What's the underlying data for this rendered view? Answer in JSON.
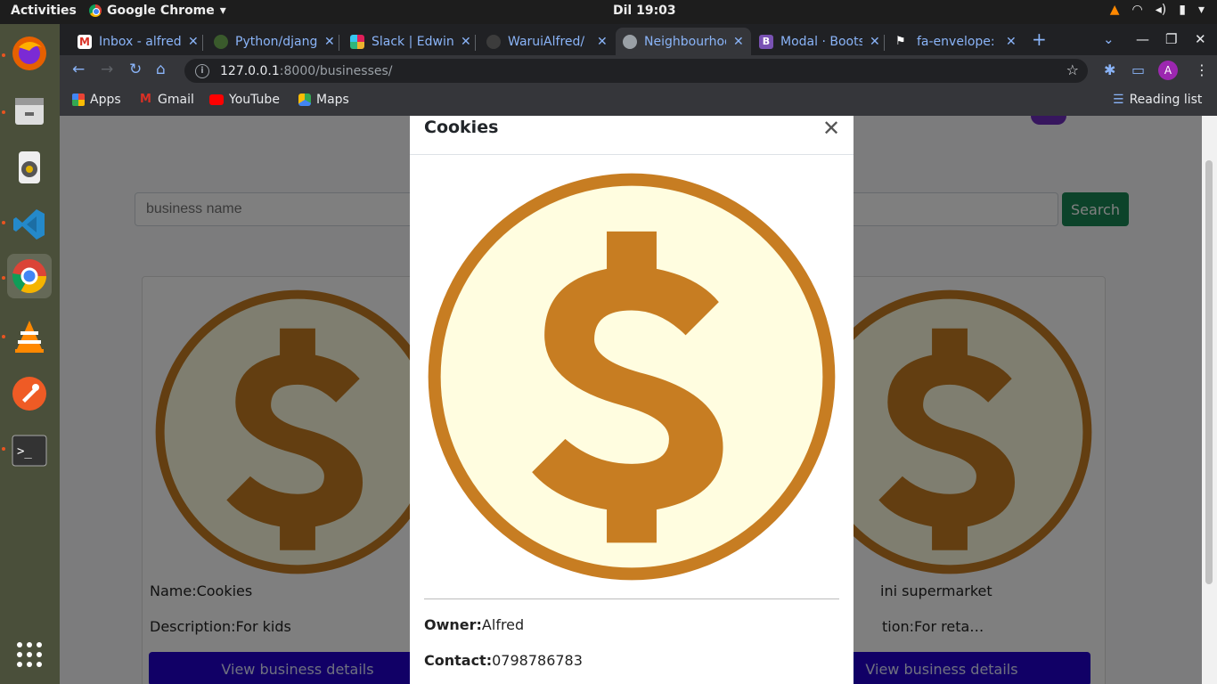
{
  "system": {
    "activities": "Activities",
    "app_menu": "Google Chrome",
    "clock": "Dil 19:03"
  },
  "browser": {
    "tabs": [
      {
        "label": "Inbox - alfred",
        "icon": "gmail-icon"
      },
      {
        "label": "Python/django",
        "icon": "python-icon"
      },
      {
        "label": "Slack | Edwin",
        "icon": "slack-icon"
      },
      {
        "label": "WaruiAlfred/",
        "icon": "github-icon"
      },
      {
        "label": "Neighbourhood",
        "icon": "globe-icon"
      },
      {
        "label": "Modal · Bootstrap",
        "icon": "bootstrap-icon"
      },
      {
        "label": "fa-envelope:",
        "icon": "flag-icon"
      }
    ],
    "url_host": "127.0.0.1",
    "url_path": ":8000/businesses/",
    "avatar_letter": "A",
    "bookmarks": [
      "Apps",
      "Gmail",
      "YouTube",
      "Maps"
    ],
    "reading_list": "Reading list"
  },
  "page": {
    "search_placeholder": "business name",
    "search_button": "Search",
    "cards": [
      {
        "name": "Name:Cookies",
        "description": "Description:For kids",
        "button": "View business details"
      },
      {
        "name": "ini supermarket",
        "description": "tion:For reta…",
        "button": "View business details"
      }
    ]
  },
  "modal": {
    "title": "Cookies",
    "owner_label": "Owner:",
    "owner": "Alfred",
    "contact_label": "Contact:",
    "contact": "0798786783"
  },
  "colors": {
    "coin_outer": "#c77d22",
    "coin_inner": "#fffde0",
    "dollar": "#c77d22",
    "view_button": "#2200cc",
    "search_button": "#198754"
  }
}
